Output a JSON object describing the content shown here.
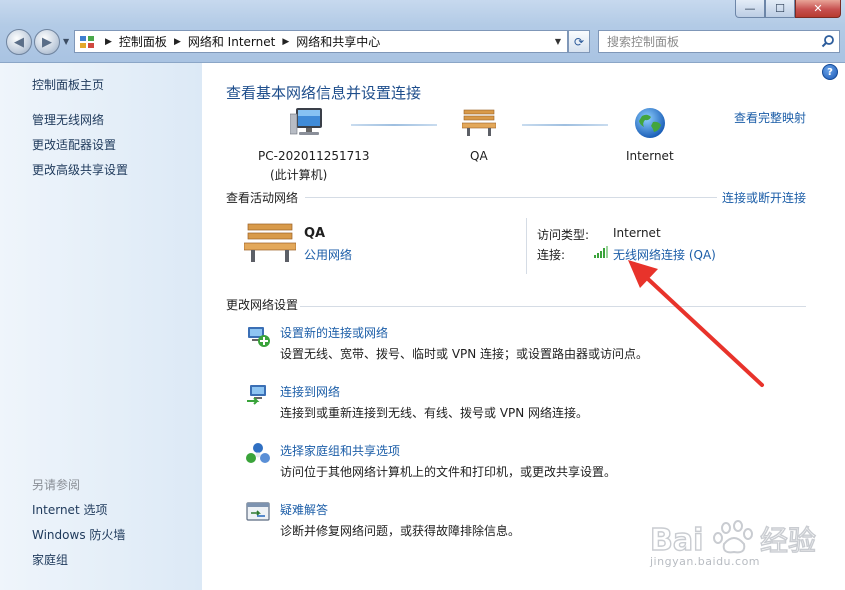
{
  "window": {
    "breadcrumb": [
      "控制面板",
      "网络和 Internet",
      "网络和共享中心"
    ],
    "search_placeholder": "搜索控制面板",
    "buttons": {
      "minimize": "—",
      "maximize": "☐",
      "close": "✕"
    }
  },
  "sidebar": {
    "home": "控制面板主页",
    "links": [
      "管理无线网络",
      "更改适配器设置",
      "更改高级共享设置"
    ],
    "see_also_title": "另请参阅",
    "see_also": [
      "Internet 选项",
      "Windows 防火墙",
      "家庭组"
    ]
  },
  "main": {
    "title": "查看基本网络信息并设置连接",
    "full_map_link": "查看完整映射",
    "map": {
      "computer_name": "PC-202011251713",
      "computer_sub": "(此计算机)",
      "network_name": "QA",
      "internet_label": "Internet"
    },
    "active": {
      "section_title": "查看活动网络",
      "connect_link": "连接或断开连接",
      "network_name": "QA",
      "network_type": "公用网络",
      "access_type_label": "访问类型:",
      "access_type_value": "Internet",
      "connections_label": "连接:",
      "connection_value": "无线网络连接 (QA)"
    },
    "change_settings": {
      "section_title": "更改网络设置",
      "tasks": [
        {
          "link": "设置新的连接或网络",
          "desc": "设置无线、宽带、拨号、临时或 VPN 连接；或设置路由器或访问点。"
        },
        {
          "link": "连接到网络",
          "desc": "连接到或重新连接到无线、有线、拨号或 VPN 网络连接。"
        },
        {
          "link": "选择家庭组和共享选项",
          "desc": "访问位于其他网络计算机上的文件和打印机，或更改共享设置。"
        },
        {
          "link": "疑难解答",
          "desc": "诊断并修复网络问题，或获得故障排除信息。"
        }
      ]
    }
  },
  "watermark": {
    "brand": "Bai",
    "brand2": "经验",
    "url": "jingyan.baidu.com"
  },
  "colors": {
    "link": "#1c5ea8",
    "title": "#1e4e8c",
    "arrow": "#e8332b",
    "signal": "#3aa33a"
  }
}
